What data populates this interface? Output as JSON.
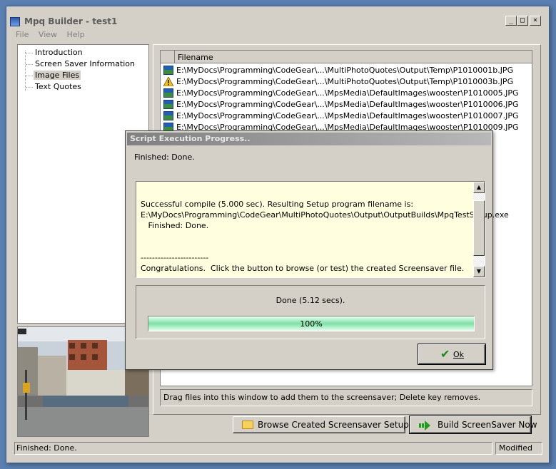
{
  "window": {
    "title": "Mpq Builder - test1",
    "controls": [
      "_",
      "□",
      "×"
    ]
  },
  "menu": [
    "File",
    "View",
    "Help"
  ],
  "tree": {
    "items": [
      {
        "label": "Introduction",
        "selected": false
      },
      {
        "label": "Screen Saver Information",
        "selected": false
      },
      {
        "label": "Image Files",
        "selected": true
      },
      {
        "label": "Text Quotes",
        "selected": false
      }
    ]
  },
  "filelist": {
    "column_header": "Filename",
    "rows": [
      {
        "icon": "image-icon",
        "name": "E:\\MyDocs\\Programming\\CodeGear\\...\\MultiPhotoQuotes\\Output\\Temp\\P1010001b.JPG"
      },
      {
        "icon": "warning-icon",
        "name": "E:\\MyDocs\\Programming\\CodeGear\\...\\MultiPhotoQuotes\\Output\\Temp\\P1010003b.JPG"
      },
      {
        "icon": "image-icon",
        "name": "E:\\MyDocs\\Programming\\CodeGear\\...\\MpsMedia\\DefaultImages\\wooster\\P1010005.JPG"
      },
      {
        "icon": "image-icon",
        "name": "E:\\MyDocs\\Programming\\CodeGear\\...\\MpsMedia\\DefaultImages\\wooster\\P1010006.JPG"
      },
      {
        "icon": "image-icon",
        "name": "E:\\MyDocs\\Programming\\CodeGear\\...\\MpsMedia\\DefaultImages\\wooster\\P1010007.JPG"
      },
      {
        "icon": "image-icon",
        "name": "E:\\MyDocs\\Programming\\CodeGear\\...\\MpsMedia\\DefaultImages\\wooster\\P1010009.JPG"
      }
    ]
  },
  "hint": "Drag files into this window to add them to the screensaver; Delete key removes.",
  "buttons": {
    "browse": "Browse Created Screensaver Setup Files",
    "build": "Build ScreenSaver Now"
  },
  "statusbar": {
    "left": "Finished: Done.",
    "right": "Modified"
  },
  "dialog": {
    "title": "Script Execution Progress..",
    "status": "Finished: Done.",
    "log": [
      "Successful compile (5.000 sec). Resulting Setup program filename is:",
      "E:\\MyDocs\\Programming\\CodeGear\\MultiPhotoQuotes\\Output\\OutputBuilds\\MpqTestSetup.exe",
      "   Finished: Done.",
      "",
      "",
      "------------------------",
      "Congratulations.  Click the button to browse (or test) the created Screensaver file."
    ],
    "progress_label": "Done (5.12 secs).",
    "progress_fraction": 1.0,
    "progress_text": "100%",
    "ok_label": "Ok"
  },
  "colors": {
    "face": "#d4d0c8",
    "log_bg": "#ffffe0",
    "progress": "#7de0a6",
    "desktop": "#5a7fb0"
  }
}
